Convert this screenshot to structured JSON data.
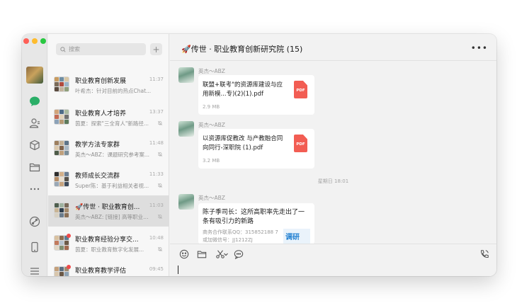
{
  "window": {
    "title": "🚀传世 · 职业教育创新研究院 (15)",
    "more_label": "•••"
  },
  "search": {
    "placeholder": "搜索",
    "add_label": "+"
  },
  "chats": [
    {
      "name": "职业教育创新发展",
      "time": "11:37",
      "preview": "叶希杰：针对目前的热点Chat...",
      "muted": false,
      "unread": false,
      "colors": [
        "#c89b5f",
        "#6f8ea3",
        "#d9c7a5",
        "#7a6a58",
        "#b04a3c",
        "#9bb5c8",
        "#5a4a3e",
        "#c2b39c",
        "#8f9f7a"
      ]
    },
    {
      "name": "职业教育人才培养",
      "time": "13:37",
      "preview": "茵夏：探索\"三全育人\"新路径...",
      "muted": true,
      "unread": false,
      "colors": [
        "#d1a47a",
        "#4e6b88",
        "#a9b9a0",
        "#c46a53",
        "#e2d1b8",
        "#6f6f6f",
        "#8ca2b8",
        "#b79a74",
        "#5e7b5c"
      ]
    },
    {
      "name": "教学方法专家群",
      "time": "11:48",
      "preview": "英杰～ABZ：课题研究参考案...",
      "muted": true,
      "unread": false,
      "colors": [
        "#9e8060",
        "#c3b095",
        "#5d7489",
        "#dcc9ad",
        "#7f624a",
        "#a8b8c6",
        "#4f5d4a",
        "#bfa07c",
        "#7c8f9a"
      ]
    },
    {
      "name": "教师成长交流群",
      "time": "11:33",
      "preview": "Super陈：基于利益相关者视...",
      "muted": true,
      "unread": false,
      "colors": [
        "#2e2e2e",
        "#d3b08a",
        "#6c7e92",
        "#b58c66",
        "#eae0d0",
        "#58524a",
        "#9aa8b6",
        "#c7a47f",
        "#3d4a5a"
      ]
    },
    {
      "name": "🚀传世 · 职业教育创...",
      "time": "11:03",
      "preview": "英杰～ABZ: [链接] 高等职业教育...",
      "muted": true,
      "unread": false,
      "colors": [
        "#4f5f4f",
        "#9fb2a0",
        "#7a6a5a",
        "#c9b596",
        "#2f3e4c",
        "#a58b6c",
        "#d7d0c2",
        "#6a7c8c",
        "#8a6f55"
      ]
    },
    {
      "name": "职业教育经验分享交...",
      "time": "10:48",
      "preview": "茵夏：职业教育数字化发展...",
      "muted": true,
      "unread": true,
      "colors": [
        "#d9c1a0",
        "#8e6c4f",
        "#5c7a8f",
        "#c27b5e",
        "#b7c4cf",
        "#6b5a48",
        "#e1d6c4",
        "#7f8f72",
        "#a36a4f"
      ]
    },
    {
      "name": "职业教育教学评估",
      "time": "09:45",
      "preview": "叶希杰：针对目前的热点...",
      "muted": true,
      "unread": true,
      "colors": [
        "#c4a07a",
        "#5b6e80",
        "#9e8a70",
        "#d8c6ac",
        "#6a5846",
        "#8fa3b4",
        "#b88f68",
        "#4a5948",
        "#c9b9a2"
      ]
    }
  ],
  "messages": {
    "sender": "英杰～ABZ",
    "file1": {
      "name": "联盟+联考\"的资源库建设与应用新模...专)(2)(1).pdf",
      "size": "2.9 MB",
      "icon": "PDF"
    },
    "file2": {
      "name": "以资源库促教改  与产教融合同向同行-深职院 (1).pdf",
      "size": "3.2 MB",
      "icon": "PDF"
    },
    "time_sep": "星期日 18:01",
    "link": {
      "title": "陈子季司长：这所高职率先走出了一条有吸引力的新路",
      "desc": "商务合作联系QQ：315852188 7 或加微信号：JJ1212ZJ",
      "thumb": "调研"
    }
  }
}
